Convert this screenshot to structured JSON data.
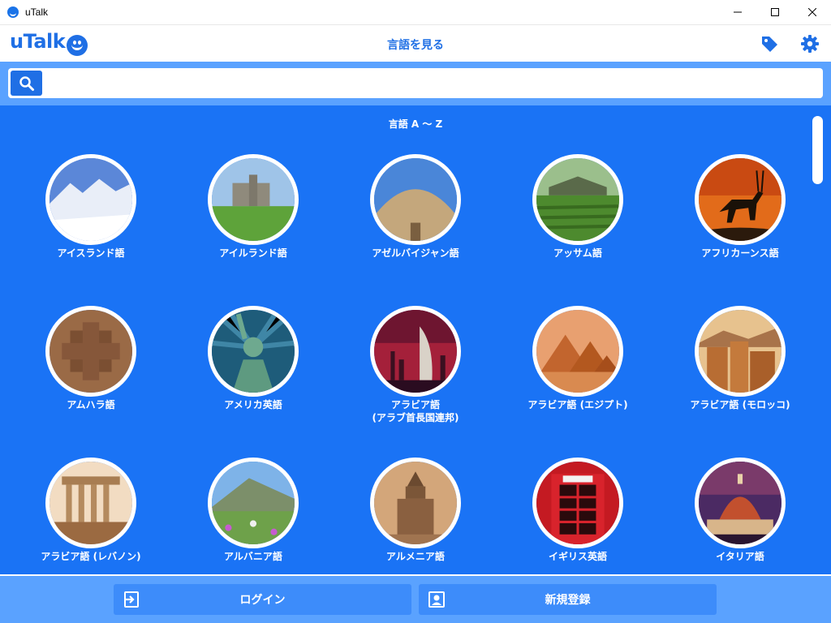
{
  "window": {
    "title": "uTalk"
  },
  "header": {
    "logo": "uTalk",
    "title": "言語を見る"
  },
  "search": {
    "placeholder": ""
  },
  "section": {
    "title": "言語 A 〜 Z"
  },
  "languages": [
    {
      "label": "アイスランド語",
      "icon": "snowy-mountains-image"
    },
    {
      "label": "アイルランド語",
      "icon": "castle-ruins-image"
    },
    {
      "label": "アゼルバイジャン語",
      "icon": "dome-building-image"
    },
    {
      "label": "アッサム語",
      "icon": "tea-plantation-image"
    },
    {
      "label": "アフリカーンス語",
      "icon": "oryx-sunset-image"
    },
    {
      "label": "アムハラ語",
      "icon": "rock-church-image"
    },
    {
      "label": "アメリカ英語",
      "icon": "statue-of-liberty-image"
    },
    {
      "label": "アラビア語\n(アラブ首長国連邦)",
      "icon": "dubai-skyline-image"
    },
    {
      "label": "アラビア語 (エジプト)",
      "icon": "pyramids-image"
    },
    {
      "label": "アラビア語 (モロッコ)",
      "icon": "kasbah-image"
    },
    {
      "label": "アラビア語 (レバノン)",
      "icon": "baalbek-columns-image"
    },
    {
      "label": "アルバニア語",
      "icon": "mountain-flowers-image"
    },
    {
      "label": "アルメニア語",
      "icon": "armenian-church-image"
    },
    {
      "label": "イギリス英語",
      "icon": "red-phone-box-image"
    },
    {
      "label": "イタリア語",
      "icon": "florence-dome-image"
    }
  ],
  "footer": {
    "login": "ログイン",
    "register": "新規登録"
  },
  "colors": {
    "brand": "#1f6fe5",
    "main_bg": "#1a73f5",
    "bar_bg": "#5aa2ff",
    "button_bg": "#3d8cfa"
  }
}
